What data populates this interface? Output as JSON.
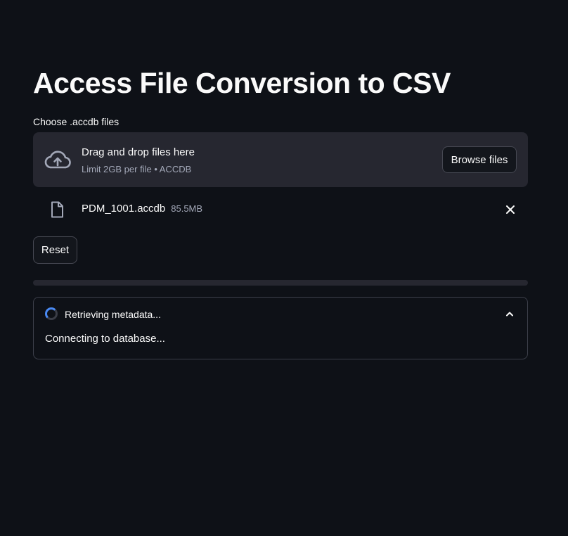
{
  "page": {
    "title": "Access File Conversion to CSV"
  },
  "uploader": {
    "label": "Choose .accdb files",
    "dropzone_text": "Drag and drop files here",
    "limit_text": "Limit 2GB per file • ACCDB",
    "browse_label": "Browse files",
    "icon": "cloud-upload-icon"
  },
  "files": [
    {
      "name": "PDM_1001.accdb",
      "size": "85.5MB",
      "icon": "file-icon"
    }
  ],
  "actions": {
    "reset_label": "Reset"
  },
  "progress": {
    "value": 0
  },
  "status": {
    "label": "Retrieving metadata...",
    "body": "Connecting to database...",
    "expanded": true
  },
  "colors": {
    "background": "#0e1117",
    "panel": "#262730",
    "text": "#fafafa",
    "muted": "#a3a8b8",
    "spinner_accent": "#4a8af4"
  }
}
